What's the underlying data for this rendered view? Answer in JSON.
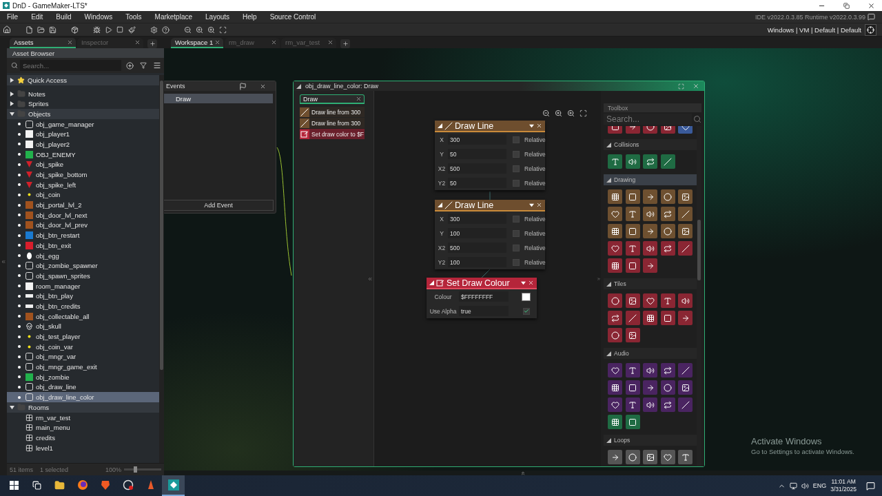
{
  "window": {
    "title": "DnD - GameMaker-LTS*"
  },
  "menu": [
    "File",
    "Edit",
    "Build",
    "Windows",
    "Tools",
    "Marketplace",
    "Layouts",
    "Help",
    "Source Control"
  ],
  "version_info": "IDE v2022.0.3.85  Runtime v2022.0.3.99",
  "target": "Windows | VM | Default | Default",
  "left_tabs": [
    {
      "label": "Assets",
      "selected": true
    },
    {
      "label": "Inspector",
      "selected": false
    }
  ],
  "workspace_tabs": [
    {
      "label": "Workspace 1",
      "selected": true
    },
    {
      "label": "rm_draw",
      "selected": false
    },
    {
      "label": "rm_var_test",
      "selected": false
    }
  ],
  "asset_browser": {
    "title": "Asset Browser",
    "search": {
      "placeholder": "Search..."
    },
    "tree": [
      {
        "label": "Quick Access",
        "kind": "star",
        "expanded": false,
        "selected": false
      },
      {
        "label": "Notes",
        "kind": "folder",
        "expanded": false,
        "selected": false
      },
      {
        "label": "Sprites",
        "kind": "folder",
        "expanded": false,
        "selected": false
      },
      {
        "label": "Objects",
        "kind": "folder",
        "expanded": true,
        "selected": false,
        "children": [
          {
            "label": "obj_game_manager",
            "kind": "script",
            "selected": false
          },
          {
            "label": "obj_player1",
            "kind": "white",
            "selected": false
          },
          {
            "label": "obj_player2",
            "kind": "white",
            "selected": false
          },
          {
            "label": "OBJ_ENEMY",
            "kind": "green",
            "selected": false
          },
          {
            "label": "obj_spike",
            "kind": "spike",
            "selected": false
          },
          {
            "label": "obj_spike_bottom",
            "kind": "spike",
            "selected": false
          },
          {
            "label": "obj_spike_left",
            "kind": "spike",
            "selected": false
          },
          {
            "label": "obj_coin",
            "kind": "coin",
            "selected": false
          },
          {
            "label": "obj_portal_lvl_2",
            "kind": "brown",
            "selected": false
          },
          {
            "label": "obj_door_lvl_next",
            "kind": "brown",
            "selected": false
          },
          {
            "label": "obj_door_lvl_prev",
            "kind": "brown",
            "selected": false
          },
          {
            "label": "obj_btn_restart",
            "kind": "blue",
            "selected": false
          },
          {
            "label": "obj_btn_exit",
            "kind": "red",
            "selected": false
          },
          {
            "label": "obj_egg",
            "kind": "egg",
            "selected": false
          },
          {
            "label": "obj_zombie_spawner",
            "kind": "script",
            "selected": false
          },
          {
            "label": "obj_spawn_sprites",
            "kind": "script",
            "selected": false
          },
          {
            "label": "room_manager",
            "kind": "white",
            "selected": false
          },
          {
            "label": "obj_btn_play",
            "kind": "banner",
            "selected": false
          },
          {
            "label": "obj_btn_credits",
            "kind": "banner",
            "selected": false
          },
          {
            "label": "obj_collectable_all",
            "kind": "brown",
            "selected": false
          },
          {
            "label": "obj_skull",
            "kind": "skull",
            "selected": false
          },
          {
            "label": "obj_test_player",
            "kind": "coin",
            "selected": false
          },
          {
            "label": "obj_coin_var",
            "kind": "coin",
            "selected": false
          },
          {
            "label": "obj_mngr_var",
            "kind": "script",
            "selected": false
          },
          {
            "label": "obj_mngr_game_exit",
            "kind": "script",
            "selected": false
          },
          {
            "label": "obj_zombie",
            "kind": "green",
            "selected": false
          },
          {
            "label": "obj_draw_line",
            "kind": "script",
            "selected": false
          },
          {
            "label": "obj_draw_line_color",
            "kind": "script",
            "selected": true
          }
        ]
      },
      {
        "label": "Rooms",
        "kind": "folder",
        "expanded": true,
        "selected": false,
        "children": [
          {
            "label": "rm_var_test",
            "kind": "room",
            "selected": false
          },
          {
            "label": "main_menu",
            "kind": "room",
            "selected": false
          },
          {
            "label": "credits",
            "kind": "room",
            "selected": false
          },
          {
            "label": "level1",
            "kind": "room",
            "selected": false
          }
        ]
      }
    ],
    "status": {
      "items": "51 items",
      "selected": "1 selected",
      "zoom": "100%",
      "level": 0.3
    }
  },
  "events_window": {
    "title": "Events",
    "events": [
      {
        "label": "Draw",
        "selected": true
      }
    ],
    "add_button": "Add Event"
  },
  "object_window": {
    "title": "obj_draw_line_color: Draw",
    "tab": {
      "label": "Draw",
      "selected": true
    },
    "actions": [
      {
        "kind": "draw",
        "label": "Draw line from 300"
      },
      {
        "kind": "draw",
        "label": "Draw line from 300"
      },
      {
        "kind": "colour",
        "label": "Set draw color to $F"
      }
    ],
    "nodes": [
      {
        "kind": "draw",
        "title": "Draw Line",
        "fields": [
          {
            "kind": "relative",
            "label": "X",
            "value": "300",
            "option": "Relative",
            "checked": false
          },
          {
            "kind": "relative",
            "label": "Y",
            "value": "50",
            "option": "Relative",
            "checked": false
          },
          {
            "kind": "relative",
            "label": "X2",
            "value": "500",
            "option": "Relative",
            "checked": false
          },
          {
            "kind": "relative",
            "label": "Y2",
            "value": "50",
            "option": "Relative",
            "checked": false
          }
        ]
      },
      {
        "kind": "draw",
        "title": "Draw Line",
        "fields": [
          {
            "kind": "relative",
            "label": "X",
            "value": "300",
            "option": "Relative",
            "checked": false
          },
          {
            "kind": "relative",
            "label": "Y",
            "value": "100",
            "option": "Relative",
            "checked": false
          },
          {
            "kind": "relative",
            "label": "X2",
            "value": "500",
            "option": "Relative",
            "checked": false
          },
          {
            "kind": "relative",
            "label": "Y2",
            "value": "100",
            "option": "Relative",
            "checked": false
          }
        ]
      },
      {
        "kind": "colour",
        "title": "Set Draw Colour",
        "fields": [
          {
            "kind": "colour",
            "label": "Colour",
            "value": "$FFFFFFFF",
            "color": "#ffffff"
          },
          {
            "kind": "toggle",
            "label": "Use Alpha",
            "value": "true",
            "checked": true
          }
        ]
      }
    ]
  },
  "toolbox": {
    "title": "Toolbox",
    "search": {
      "placeholder": "Search..."
    },
    "sections": [
      {
        "tools": [
          {
            "color": "#8a2633"
          },
          {
            "color": "#8a2633"
          },
          {
            "color": "#8a2633"
          },
          {
            "color": "#8a2633"
          },
          {
            "color": "#3a5a9a"
          }
        ]
      },
      {
        "title": "Collisions",
        "expanded": true,
        "selected": false,
        "tools": [
          {
            "color": "#1f6b43"
          },
          {
            "color": "#1f6b43"
          },
          {
            "color": "#1f6b43"
          },
          {
            "color": "#1f6b43"
          }
        ]
      },
      {
        "title": "Drawing",
        "expanded": true,
        "selected": true,
        "tools": [
          {
            "color": "#6e5030"
          },
          {
            "color": "#6e5030"
          },
          {
            "color": "#6e5030"
          },
          {
            "color": "#6e5030"
          },
          {
            "color": "#6e5030"
          },
          {
            "color": "#6e5030"
          },
          {
            "color": "#6e5030"
          },
          {
            "color": "#6e5030"
          },
          {
            "color": "#6e5030"
          },
          {
            "color": "#6e5030"
          },
          {
            "color": "#6e5030"
          },
          {
            "color": "#6e5030"
          },
          {
            "color": "#6e5030"
          },
          {
            "color": "#6e5030"
          },
          {
            "color": "#6e5030"
          },
          {
            "color": "#8a2633"
          },
          {
            "color": "#8a2633"
          },
          {
            "color": "#8a2633"
          },
          {
            "color": "#8a2633"
          },
          {
            "color": "#8a2633"
          },
          {
            "color": "#8a2633"
          },
          {
            "color": "#8a2633"
          },
          {
            "color": "#8a2633"
          }
        ]
      },
      {
        "title": "Tiles",
        "expanded": true,
        "selected": false,
        "tools": [
          {
            "color": "#8a2633"
          },
          {
            "color": "#8a2633"
          },
          {
            "color": "#8a2633"
          },
          {
            "color": "#8a2633"
          },
          {
            "color": "#8a2633"
          },
          {
            "color": "#8a2633"
          },
          {
            "color": "#8a2633"
          },
          {
            "color": "#8a2633"
          },
          {
            "color": "#8a2633"
          },
          {
            "color": "#8a2633"
          },
          {
            "color": "#8a2633"
          },
          {
            "color": "#8a2633"
          }
        ]
      },
      {
        "title": "Audio",
        "expanded": true,
        "selected": false,
        "tools": [
          {
            "color": "#4a2461"
          },
          {
            "color": "#4a2461"
          },
          {
            "color": "#4a2461"
          },
          {
            "color": "#4a2461"
          },
          {
            "color": "#4a2461"
          },
          {
            "color": "#4a2461"
          },
          {
            "color": "#4a2461"
          },
          {
            "color": "#4a2461"
          },
          {
            "color": "#4a2461"
          },
          {
            "color": "#4a2461"
          },
          {
            "color": "#4a2461"
          },
          {
            "color": "#4a2461"
          },
          {
            "color": "#4a2461"
          },
          {
            "color": "#4a2461"
          },
          {
            "color": "#4a2461"
          },
          {
            "color": "#1f6b43"
          },
          {
            "color": "#1f6b43"
          }
        ]
      },
      {
        "title": "Loops",
        "expanded": true,
        "selected": false,
        "tools": [
          {
            "color": "#555555"
          },
          {
            "color": "#555555"
          },
          {
            "color": "#555555"
          },
          {
            "color": "#555555"
          },
          {
            "color": "#555555"
          }
        ]
      }
    ]
  },
  "activation_notice": {
    "title": "Activate Windows",
    "subtitle": "Go to Settings to activate Windows."
  },
  "taskbar": {
    "language": "ENG",
    "time": "11:01 AM",
    "date": "3/31/2025"
  }
}
